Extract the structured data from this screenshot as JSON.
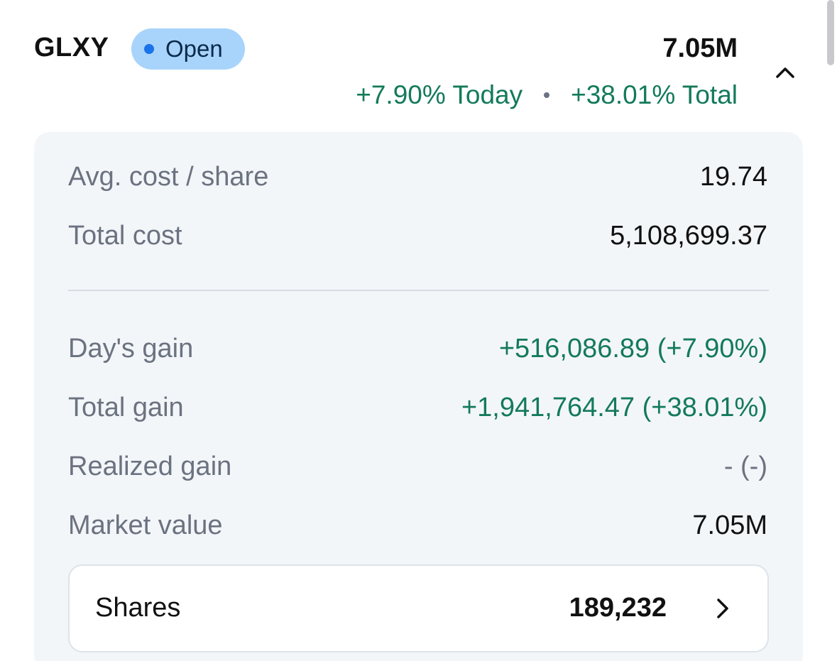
{
  "holding": {
    "ticker": "GLXY",
    "status": "Open",
    "market_value": "7.05M",
    "today_change": "+7.90% Today",
    "total_change": "+38.01% Total"
  },
  "details": {
    "avg_cost_label": "Avg. cost / share",
    "avg_cost_value": "19.74",
    "total_cost_label": "Total cost",
    "total_cost_value": "5,108,699.37",
    "days_gain_label": "Day's gain",
    "days_gain_value": "+516,086.89 (+7.90%)",
    "total_gain_label": "Total gain",
    "total_gain_value": "+1,941,764.47 (+38.01%)",
    "realized_gain_label": "Realized gain",
    "realized_gain_value": "- (-)",
    "market_value_label": "Market value",
    "market_value_value": "7.05M",
    "shares_label": "Shares",
    "shares_value": "189,232"
  },
  "colors": {
    "gain_green": "#137a5a",
    "status_pill": "#a8d4fb",
    "status_dot": "#1a73e8",
    "card_bg": "#f3f6f9"
  },
  "icons": {
    "collapse": "chevron-up-icon",
    "shares": "chevron-right-icon",
    "status": "status-dot-icon"
  }
}
